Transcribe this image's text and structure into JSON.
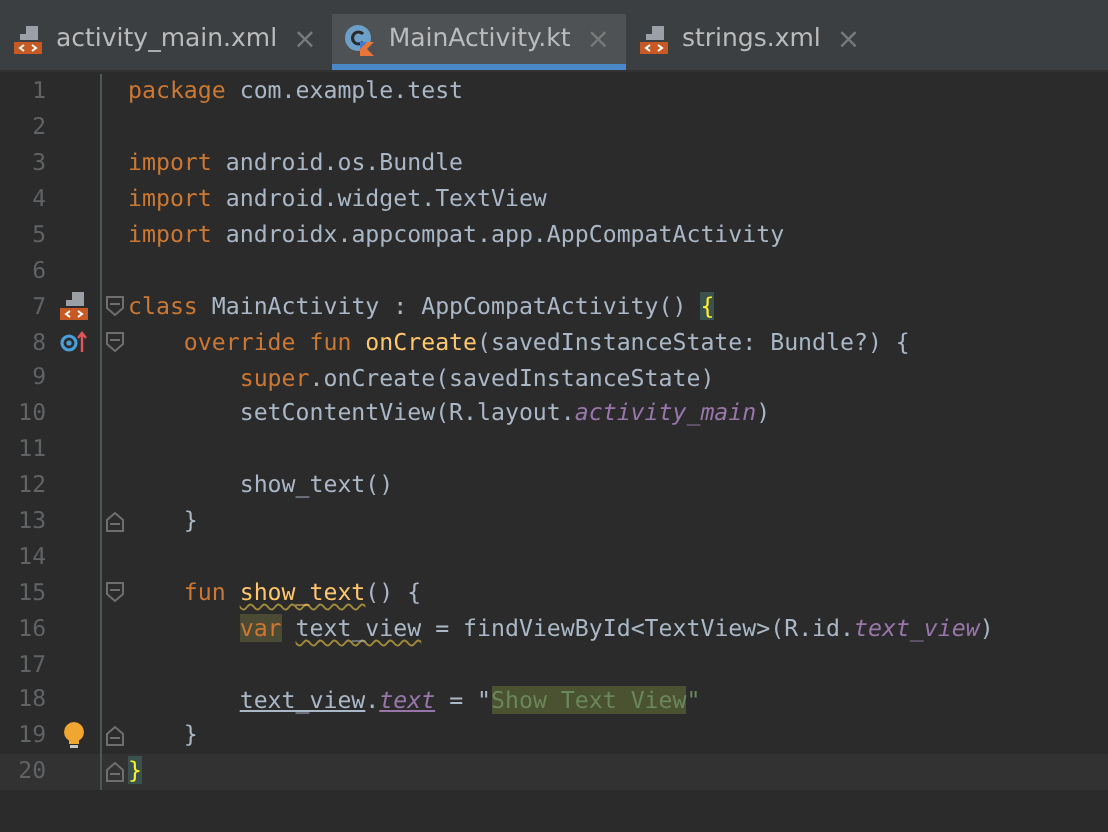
{
  "tabs": [
    {
      "label": "activity_main.xml",
      "kind": "xml",
      "selected": false,
      "close": "×"
    },
    {
      "label": "MainActivity.kt",
      "kind": "kotlin",
      "selected": true,
      "close": "×"
    },
    {
      "label": "strings.xml",
      "kind": "xml",
      "selected": false,
      "close": "×"
    }
  ],
  "lines": [
    {
      "number": "1",
      "tokens": [
        {
          "text": "package ",
          "kind": "keyword"
        },
        {
          "text": "com.example.test",
          "kind": "plain"
        }
      ]
    },
    {
      "number": "2"
    },
    {
      "number": "3",
      "tokens": [
        {
          "text": "import ",
          "kind": "keyword"
        },
        {
          "text": "android.os.Bundle",
          "kind": "plain"
        }
      ]
    },
    {
      "number": "4",
      "tokens": [
        {
          "text": "import ",
          "kind": "keyword"
        },
        {
          "text": "android.widget.TextView",
          "kind": "plain"
        }
      ]
    },
    {
      "number": "5",
      "tokens": [
        {
          "text": "import ",
          "kind": "keyword"
        },
        {
          "text": "androidx.appcompat.app.AppCompatActivity",
          "kind": "plain"
        }
      ]
    },
    {
      "number": "6"
    },
    {
      "number": "7",
      "layout_marker": true,
      "fold_start": true,
      "tokens": [
        {
          "text": "class ",
          "kind": "keyword"
        },
        {
          "text": "MainActivity : AppCompatActivity() ",
          "kind": "plain"
        },
        {
          "text": "{",
          "kind": "match"
        }
      ]
    },
    {
      "number": "8",
      "override_marker": true,
      "fold_start": true,
      "tokens": [
        {
          "text": "    override fun ",
          "kind": "keyword"
        },
        {
          "text": "onCreate",
          "kind": "decl"
        },
        {
          "text": "(savedInstanceState: Bundle?) {",
          "kind": "plain"
        }
      ]
    },
    {
      "number": "9",
      "tokens": [
        {
          "text": "        super",
          "kind": "keyword"
        },
        {
          "text": ".onCreate(savedInstanceState)",
          "kind": "plain"
        }
      ]
    },
    {
      "number": "10",
      "tokens": [
        {
          "text": "        setContentView(R.layout.",
          "kind": "plain"
        },
        {
          "text": "activity_main",
          "kind": "field"
        },
        {
          "text": ")",
          "kind": "plain"
        }
      ]
    },
    {
      "number": "11"
    },
    {
      "number": "12",
      "tokens": [
        {
          "text": "        show_text()",
          "kind": "plain"
        }
      ]
    },
    {
      "number": "13",
      "fold_end": true,
      "tokens": [
        {
          "text": "    }",
          "kind": "plain"
        }
      ]
    },
    {
      "number": "14"
    },
    {
      "number": "15",
      "fold_start": true,
      "tokens": [
        {
          "text": "    fun ",
          "kind": "keyword"
        },
        {
          "text": "show_text",
          "kind": "decl_warn"
        },
        {
          "text": "() {",
          "kind": "plain"
        }
      ]
    },
    {
      "number": "16",
      "tokens": [
        {
          "text": "        var",
          "kind": "keyword_hl"
        },
        {
          "text": " text_view",
          "kind": "plain_warn"
        },
        {
          "text": " = findViewById<TextView>(R.id.",
          "kind": "plain"
        },
        {
          "text": "text_view",
          "kind": "field"
        },
        {
          "text": ")",
          "kind": "plain"
        }
      ]
    },
    {
      "number": "17"
    },
    {
      "number": "18",
      "tokens": [
        {
          "text": "        text_view",
          "kind": "var_ref"
        },
        {
          "text": ".",
          "kind": "plain"
        },
        {
          "text": "text",
          "kind": "field_ref"
        },
        {
          "text": " = \"",
          "kind": "plain"
        },
        {
          "text": "Show Text View",
          "kind": "string_hl"
        },
        {
          "text": "\"",
          "kind": "string"
        }
      ]
    },
    {
      "number": "19",
      "bulb": true,
      "fold_end": true,
      "tokens": [
        {
          "text": "    }",
          "kind": "plain"
        }
      ]
    },
    {
      "number": "20",
      "fold_end": true,
      "current": true,
      "tokens": [
        {
          "text": "}",
          "kind": "match"
        }
      ]
    }
  ]
}
